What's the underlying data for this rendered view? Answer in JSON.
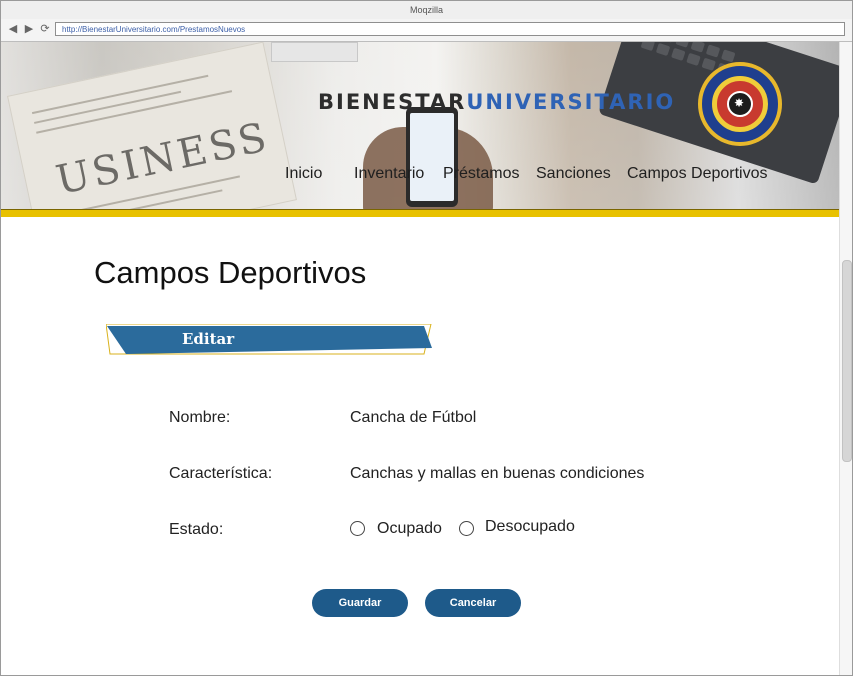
{
  "browser": {
    "title": "Moqzilla",
    "url": "http://BienestarUniversitario.com/PrestamosNuevos",
    "icons": [
      "back-icon",
      "forward-icon",
      "reload-icon"
    ]
  },
  "header": {
    "brand_part1": "BIENESTAR",
    "brand_part2": "UNIVERSITARIO",
    "background_word": "USINESS",
    "menu": [
      {
        "label": "Inicio"
      },
      {
        "label": "Inventario"
      },
      {
        "label": "Préstamos"
      },
      {
        "label": "Sanciones"
      },
      {
        "label": "Campos Deportivos"
      }
    ],
    "accent_color": "#e8c100"
  },
  "main": {
    "title": "Campos Deportivos",
    "section_label": "Editar",
    "fields": [
      {
        "label": "Nombre:",
        "value": "Cancha de Fútbol"
      },
      {
        "label": "Característica:",
        "value": "Canchas y mallas en buenas condiciones"
      }
    ],
    "estado": {
      "label": "Estado:",
      "options": [
        {
          "label": "Ocupado",
          "selected": false
        },
        {
          "label": "Desocupado",
          "selected": false
        }
      ]
    },
    "buttons": {
      "save": "Guardar",
      "cancel": "Cancelar"
    },
    "button_color": "#1e5a8a",
    "ribbon_color": "#2b6b9c"
  }
}
